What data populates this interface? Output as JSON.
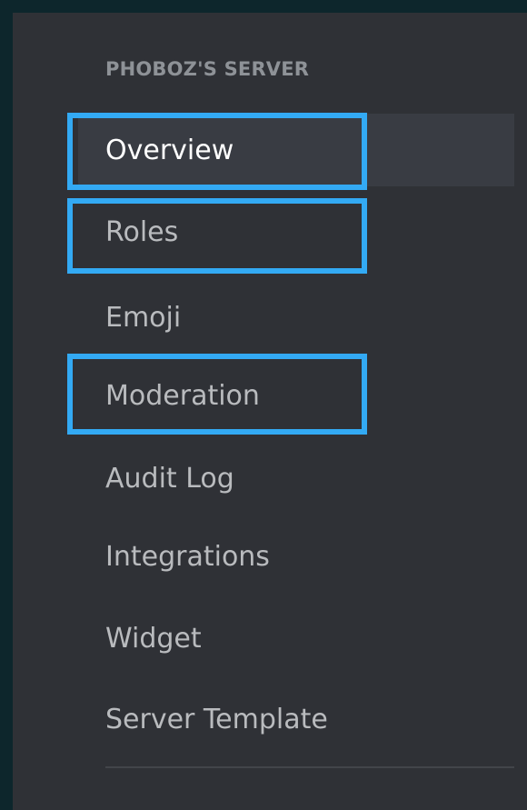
{
  "sidebar": {
    "header": "PHOBOZ'S SERVER",
    "items": [
      {
        "label": "Overview",
        "selected": true,
        "highlighted": true
      },
      {
        "label": "Roles",
        "selected": false,
        "highlighted": true
      },
      {
        "label": "Emoji",
        "selected": false,
        "highlighted": false
      },
      {
        "label": "Moderation",
        "selected": false,
        "highlighted": true
      },
      {
        "label": "Audit Log",
        "selected": false,
        "highlighted": false
      },
      {
        "label": "Integrations",
        "selected": false,
        "highlighted": false
      },
      {
        "label": "Widget",
        "selected": false,
        "highlighted": false
      },
      {
        "label": "Server Template",
        "selected": false,
        "highlighted": false
      }
    ]
  },
  "colors": {
    "background": "#0d262c",
    "panel": "#2f3136",
    "selected_bg": "#393c43",
    "header_text": "#8e9297",
    "item_text": "#b9bbbe",
    "selected_text": "#ffffff",
    "highlight_border": "#33aaf4"
  }
}
